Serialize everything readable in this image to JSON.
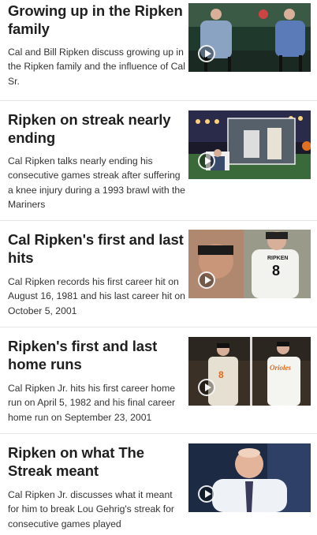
{
  "videos": [
    {
      "title": "Growing up in the Ripken family",
      "description": "Cal and Bill Ripken discuss growing up in the Ripken family and the influence of Cal Sr."
    },
    {
      "title": "Ripken on streak nearly ending",
      "description": "Cal Ripken talks nearly ending his consecutive games streak after suffering a knee injury during a 1993 brawl with the Mariners"
    },
    {
      "title": "Cal Ripken's first and last hits",
      "description": "Cal Ripken records his first career hit on August 16, 1981 and his last career hit on October 5, 2001"
    },
    {
      "title": "Ripken's first and last home runs",
      "description": "Cal Ripken Jr. hits his first career home run on April 5, 1982 and his final career home run on September 23, 2001"
    },
    {
      "title": "Ripken on what The Streak meant",
      "description": "Cal Ripken Jr. discusses what it meant for him to break Lou Gehrig's streak for consecutive games played"
    }
  ],
  "thumbnail_texts": {
    "jersey_name": "RIPKEN",
    "jersey_number": "8",
    "orioles_script": "Orioles"
  },
  "icons": {
    "play": "play-circle-icon"
  }
}
